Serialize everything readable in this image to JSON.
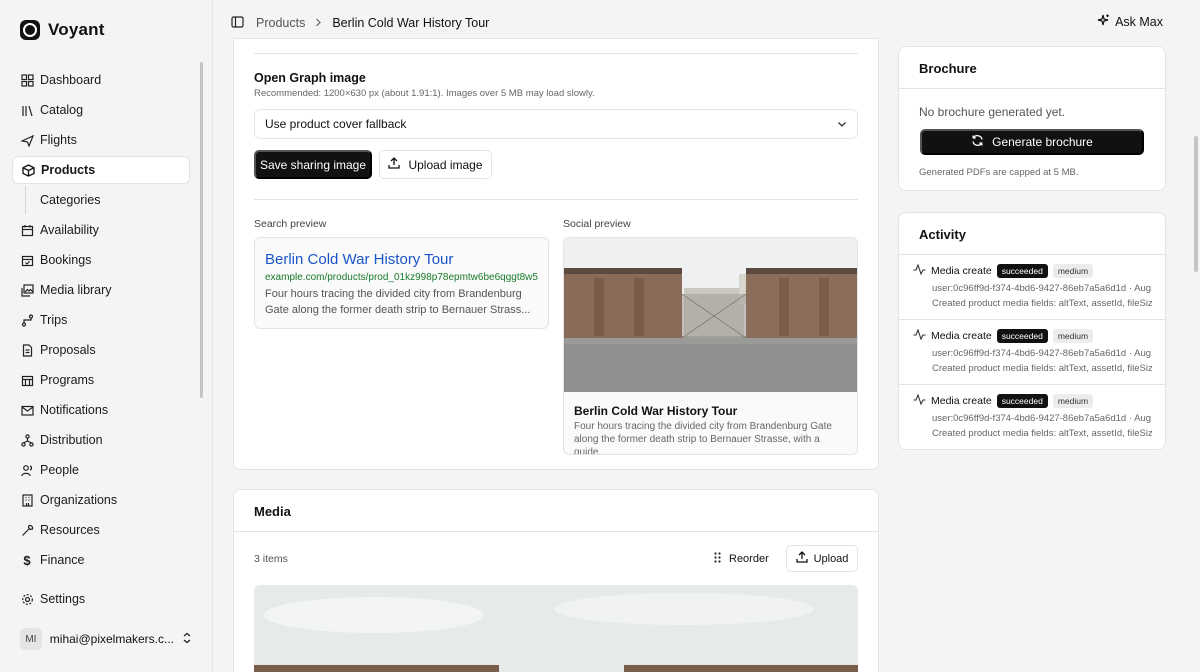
{
  "brand": {
    "name": "Voyant"
  },
  "sidebar": {
    "items": [
      {
        "label": "Dashboard",
        "icon": "dashboard-icon"
      },
      {
        "label": "Catalog",
        "icon": "catalog-icon"
      },
      {
        "label": "Flights",
        "icon": "plane-icon"
      },
      {
        "label": "Products",
        "icon": "package-icon",
        "active": true
      },
      {
        "label": "Categories",
        "sub": true
      },
      {
        "label": "Availability",
        "icon": "calendar-icon"
      },
      {
        "label": "Bookings",
        "icon": "calendar-check-icon"
      },
      {
        "label": "Media library",
        "icon": "images-icon"
      },
      {
        "label": "Trips",
        "icon": "route-icon"
      },
      {
        "label": "Proposals",
        "icon": "file-icon"
      },
      {
        "label": "Programs",
        "icon": "calendar-grid-icon"
      },
      {
        "label": "Notifications",
        "icon": "mail-icon"
      },
      {
        "label": "Distribution",
        "icon": "network-icon"
      },
      {
        "label": "People",
        "icon": "people-icon"
      },
      {
        "label": "Organizations",
        "icon": "building-icon"
      },
      {
        "label": "Resources",
        "icon": "wrench-icon"
      },
      {
        "label": "Finance",
        "icon": "dollar-icon"
      }
    ],
    "settings_label": "Settings",
    "user": {
      "initials": "MI",
      "email": "mihai@pixelmakers.c..."
    }
  },
  "topbar": {
    "breadcrumb": [
      "Products",
      "Berlin Cold War History Tour"
    ],
    "ask_label": "Ask Max"
  },
  "og": {
    "title": "Open Graph image",
    "hint": "Recommended: 1200×630 px (about 1.91:1). Images over 5 MB may load slowly.",
    "select_value": "Use product cover fallback",
    "save_label": "Save sharing image",
    "upload_label": "Upload image",
    "search_preview_label": "Search preview",
    "social_preview_label": "Social preview",
    "search": {
      "title": "Berlin Cold War History Tour",
      "url": "example.com/products/prod_01kz998p78epmtw6be6qggt8w5",
      "desc": "Four hours tracing the divided city from Brandenburg Gate along the former death strip to Bernauer Strass..."
    },
    "social": {
      "title": "Berlin Cold War History Tour",
      "desc": "Four hours tracing the divided city from Brandenburg Gate along the former death strip to Bernauer Strasse, with a guide..."
    }
  },
  "media": {
    "title": "Media",
    "count": "3 items",
    "reorder_label": "Reorder",
    "upload_label": "Upload"
  },
  "brochure": {
    "title": "Brochure",
    "empty": "No brochure generated yet.",
    "button": "Generate brochure",
    "cap": "Generated PDFs are capped at 5 MB."
  },
  "activity": {
    "title": "Activity",
    "items": [
      {
        "action": "Media create",
        "status": "succeeded",
        "level": "medium",
        "user": "user:0c96ff9d-f374-4bd6-9427-86eb7a5a6d1d · Aug...",
        "detail": "Created product media fields: altText, assetId, fileSize,..."
      },
      {
        "action": "Media create",
        "status": "succeeded",
        "level": "medium",
        "user": "user:0c96ff9d-f374-4bd6-9427-86eb7a5a6d1d · Aug...",
        "detail": "Created product media fields: altText, assetId, fileSize,..."
      },
      {
        "action": "Media create",
        "status": "succeeded",
        "level": "medium",
        "user": "user:0c96ff9d-f374-4bd6-9427-86eb7a5a6d1d · Aug...",
        "detail": "Created product media fields: altText, assetId, fileSize,..."
      }
    ]
  }
}
